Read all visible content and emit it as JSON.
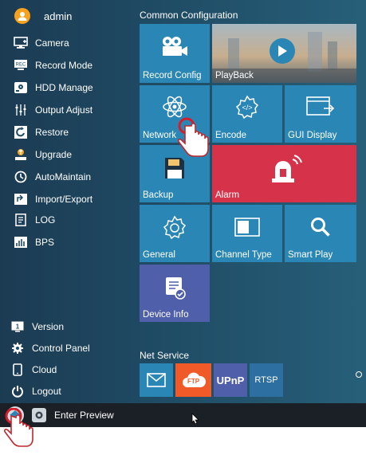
{
  "user": {
    "name": "admin"
  },
  "sidebar": {
    "items": [
      {
        "label": "Camera",
        "icon": "camera-icon"
      },
      {
        "label": "Record Mode",
        "icon": "record-mode-icon"
      },
      {
        "label": "HDD Manage",
        "icon": "hdd-icon"
      },
      {
        "label": "Output Adjust",
        "icon": "sliders-icon"
      },
      {
        "label": "Restore",
        "icon": "restore-icon"
      },
      {
        "label": "Upgrade",
        "icon": "upgrade-icon"
      },
      {
        "label": "AutoMaintain",
        "icon": "automaintain-icon"
      },
      {
        "label": "Import/Export",
        "icon": "import-export-icon"
      },
      {
        "label": "LOG",
        "icon": "log-icon"
      },
      {
        "label": "BPS",
        "icon": "bps-icon"
      }
    ],
    "bottom_items": [
      {
        "label": "Version",
        "icon": "version-icon"
      },
      {
        "label": "Control Panel",
        "icon": "gear-icon"
      },
      {
        "label": "Cloud",
        "icon": "phone-icon"
      },
      {
        "label": "Logout",
        "icon": "power-icon"
      }
    ]
  },
  "common_config": {
    "title": "Common Configuration",
    "tiles": {
      "record_config": "Record Config",
      "playback": "PlayBack",
      "network": "Network",
      "encode": "Encode",
      "gui_display": "GUI Display",
      "backup": "Backup",
      "alarm": "Alarm",
      "general": "General",
      "channel_type": "Channel Type",
      "smart_play": "Smart Play",
      "device_info": "Device Info"
    }
  },
  "net_service": {
    "title": "Net Service",
    "items": [
      "",
      "FTP",
      "UPnP",
      "RTSP"
    ]
  },
  "taskbar": {
    "preview_label": "Enter Preview"
  },
  "colors": {
    "tile_blue": "#2a86b5",
    "alarm_red": "#d6334b",
    "device_info_purple": "#4f5fa9",
    "ftp_orange": "#f05a28"
  }
}
